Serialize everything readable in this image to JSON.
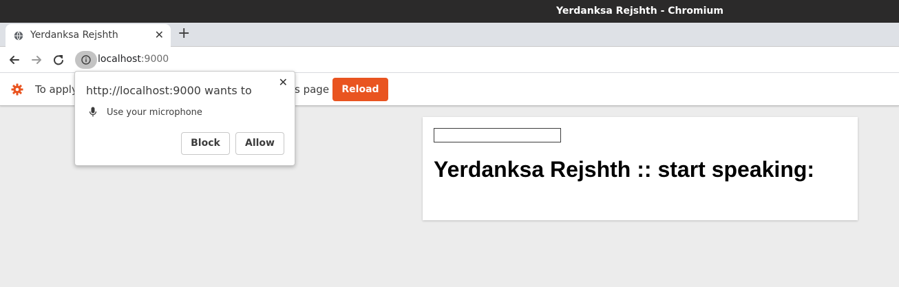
{
  "window": {
    "title": "Yerdanksa Rejshth - Chromium"
  },
  "tab": {
    "title": "Yerdanksa Rejshth",
    "close": "✕",
    "new_tab": "+"
  },
  "address_bar": {
    "host": "localhost",
    "port": ":9000"
  },
  "infobar": {
    "message_left": "To apply",
    "message_right": "s page",
    "reload_label": "Reload",
    "accent": "#e95420"
  },
  "permission": {
    "title": "http://localhost:9000 wants to",
    "item": "Use your microphone",
    "block_label": "Block",
    "allow_label": "Allow",
    "close": "✕"
  },
  "page": {
    "heading": "Yerdanksa Rejshth :: start speaking:",
    "input_value": ""
  }
}
